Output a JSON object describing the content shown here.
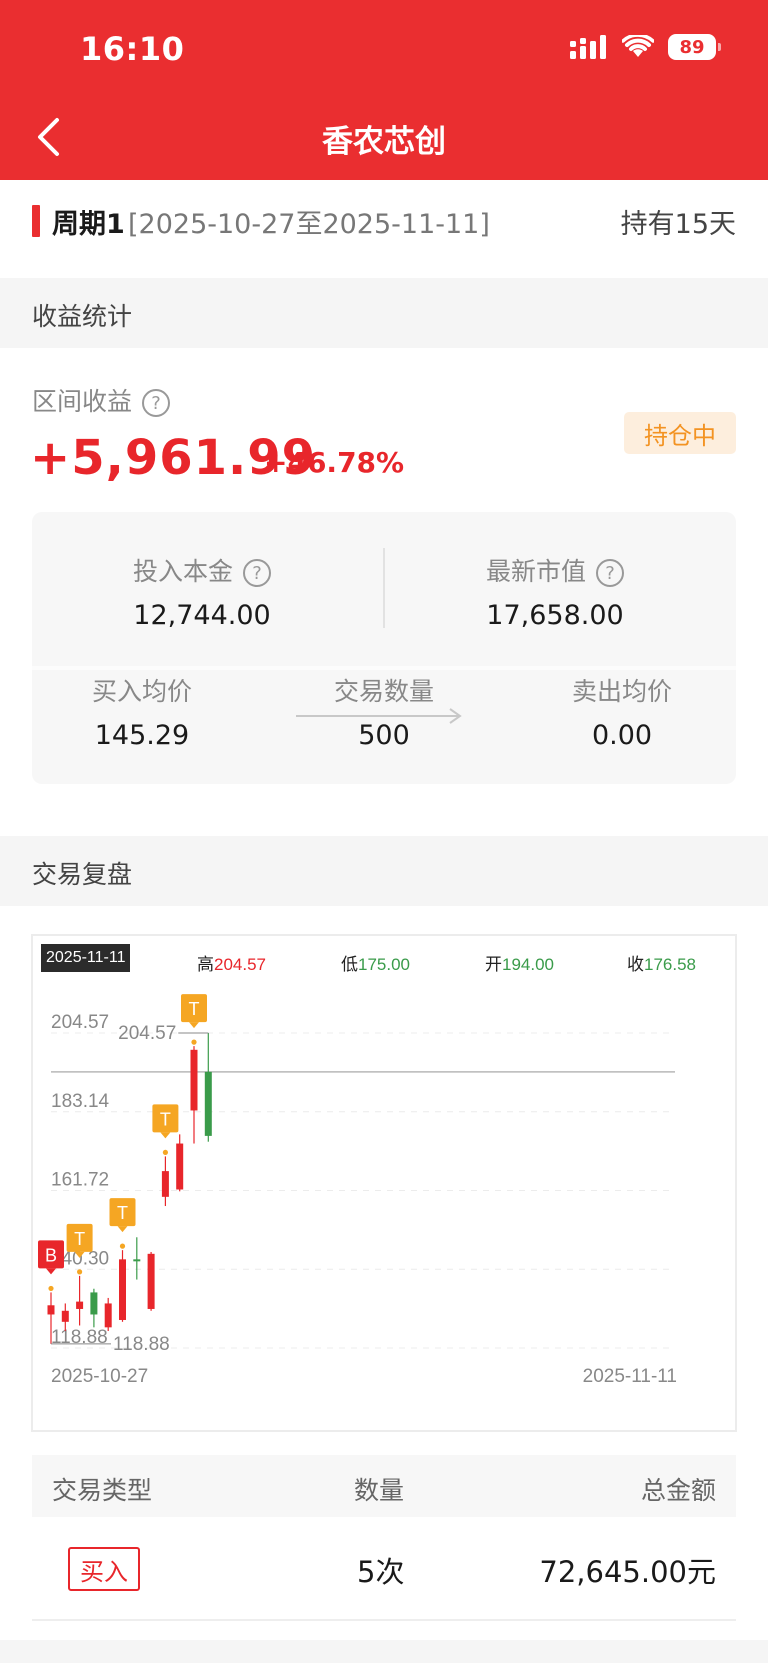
{
  "status_bar": {
    "time": "16:10",
    "battery": "89"
  },
  "nav": {
    "title": "香农芯创"
  },
  "period": {
    "label": "周期1",
    "range": "[2025-10-27至2025-11-11]",
    "hold_days": "持有15天"
  },
  "profit_section": {
    "title": "收益统计",
    "interval_label": "区间收益",
    "amount": "+5,961.99",
    "percent": "+46.78%",
    "status": "持仓中",
    "invested_label": "投入本金",
    "invested_value": "12,744.00",
    "market_label": "最新市值",
    "market_value": "17,658.00",
    "buy_avg_label": "买入均价",
    "buy_avg_value": "145.29",
    "qty_label": "交易数量",
    "qty_value": "500",
    "sell_avg_label": "卖出均价",
    "sell_avg_value": "0.00"
  },
  "replay_section": {
    "title": "交易复盘"
  },
  "chart": {
    "date_tag": "2025-11-11",
    "high_label": "高",
    "high_value": "204.57",
    "low_label": "低",
    "low_value": "175.00",
    "open_label": "开",
    "open_value": "194.00",
    "close_label": "收",
    "close_value": "176.58",
    "start_date": "2025-10-27",
    "end_date": "2025-11-11",
    "max_marker": "204.57",
    "min_marker": "118.88",
    "colors": {
      "up": "#e8262b",
      "down": "#3a9b4a",
      "marker": "#f5a623"
    }
  },
  "chart_data": {
    "type": "candlestick",
    "title": "",
    "y_ticks": [
      "204.57",
      "183.14",
      "161.72",
      "140.30",
      "118.88"
    ],
    "ylim": [
      118.88,
      204.57
    ],
    "x_range": [
      "2025-10-27",
      "2025-11-11"
    ],
    "candles": [
      {
        "open": 128.0,
        "close": 130.5,
        "high": 134.0,
        "low": 120.0,
        "marker": "B"
      },
      {
        "open": 126.0,
        "close": 129.0,
        "high": 131.0,
        "low": 123.5,
        "marker": ""
      },
      {
        "open": 129.5,
        "close": 131.5,
        "high": 138.5,
        "low": 125.0,
        "marker": "T"
      },
      {
        "open": 134.0,
        "close": 128.0,
        "high": 135.0,
        "low": 124.5,
        "marker": ""
      },
      {
        "open": 124.5,
        "close": 131.0,
        "high": 132.5,
        "low": 123.5,
        "marker": ""
      },
      {
        "open": 126.5,
        "close": 143.0,
        "high": 145.5,
        "low": 126.0,
        "marker": "T"
      },
      {
        "open": 143.0,
        "close": 142.8,
        "high": 149.0,
        "low": 137.5,
        "marker": ""
      },
      {
        "open": 129.5,
        "close": 144.5,
        "high": 145.0,
        "low": 129.0,
        "marker": ""
      },
      {
        "open": 160.0,
        "close": 167.0,
        "high": 171.0,
        "low": 157.5,
        "marker": "T"
      },
      {
        "open": 162.0,
        "close": 174.5,
        "high": 177.0,
        "low": 161.5,
        "marker": ""
      },
      {
        "open": 183.5,
        "close": 200.0,
        "high": 201.0,
        "low": 174.5,
        "marker": "T"
      },
      {
        "open": 194.0,
        "close": 176.58,
        "high": 204.57,
        "low": 175.0,
        "marker": ""
      }
    ],
    "reference_line": 194.0
  },
  "trade_table": {
    "headers": [
      "交易类型",
      "数量",
      "总金额"
    ],
    "rows": [
      {
        "type": "买入",
        "count": "5次",
        "total": "72,645.00元"
      }
    ]
  }
}
